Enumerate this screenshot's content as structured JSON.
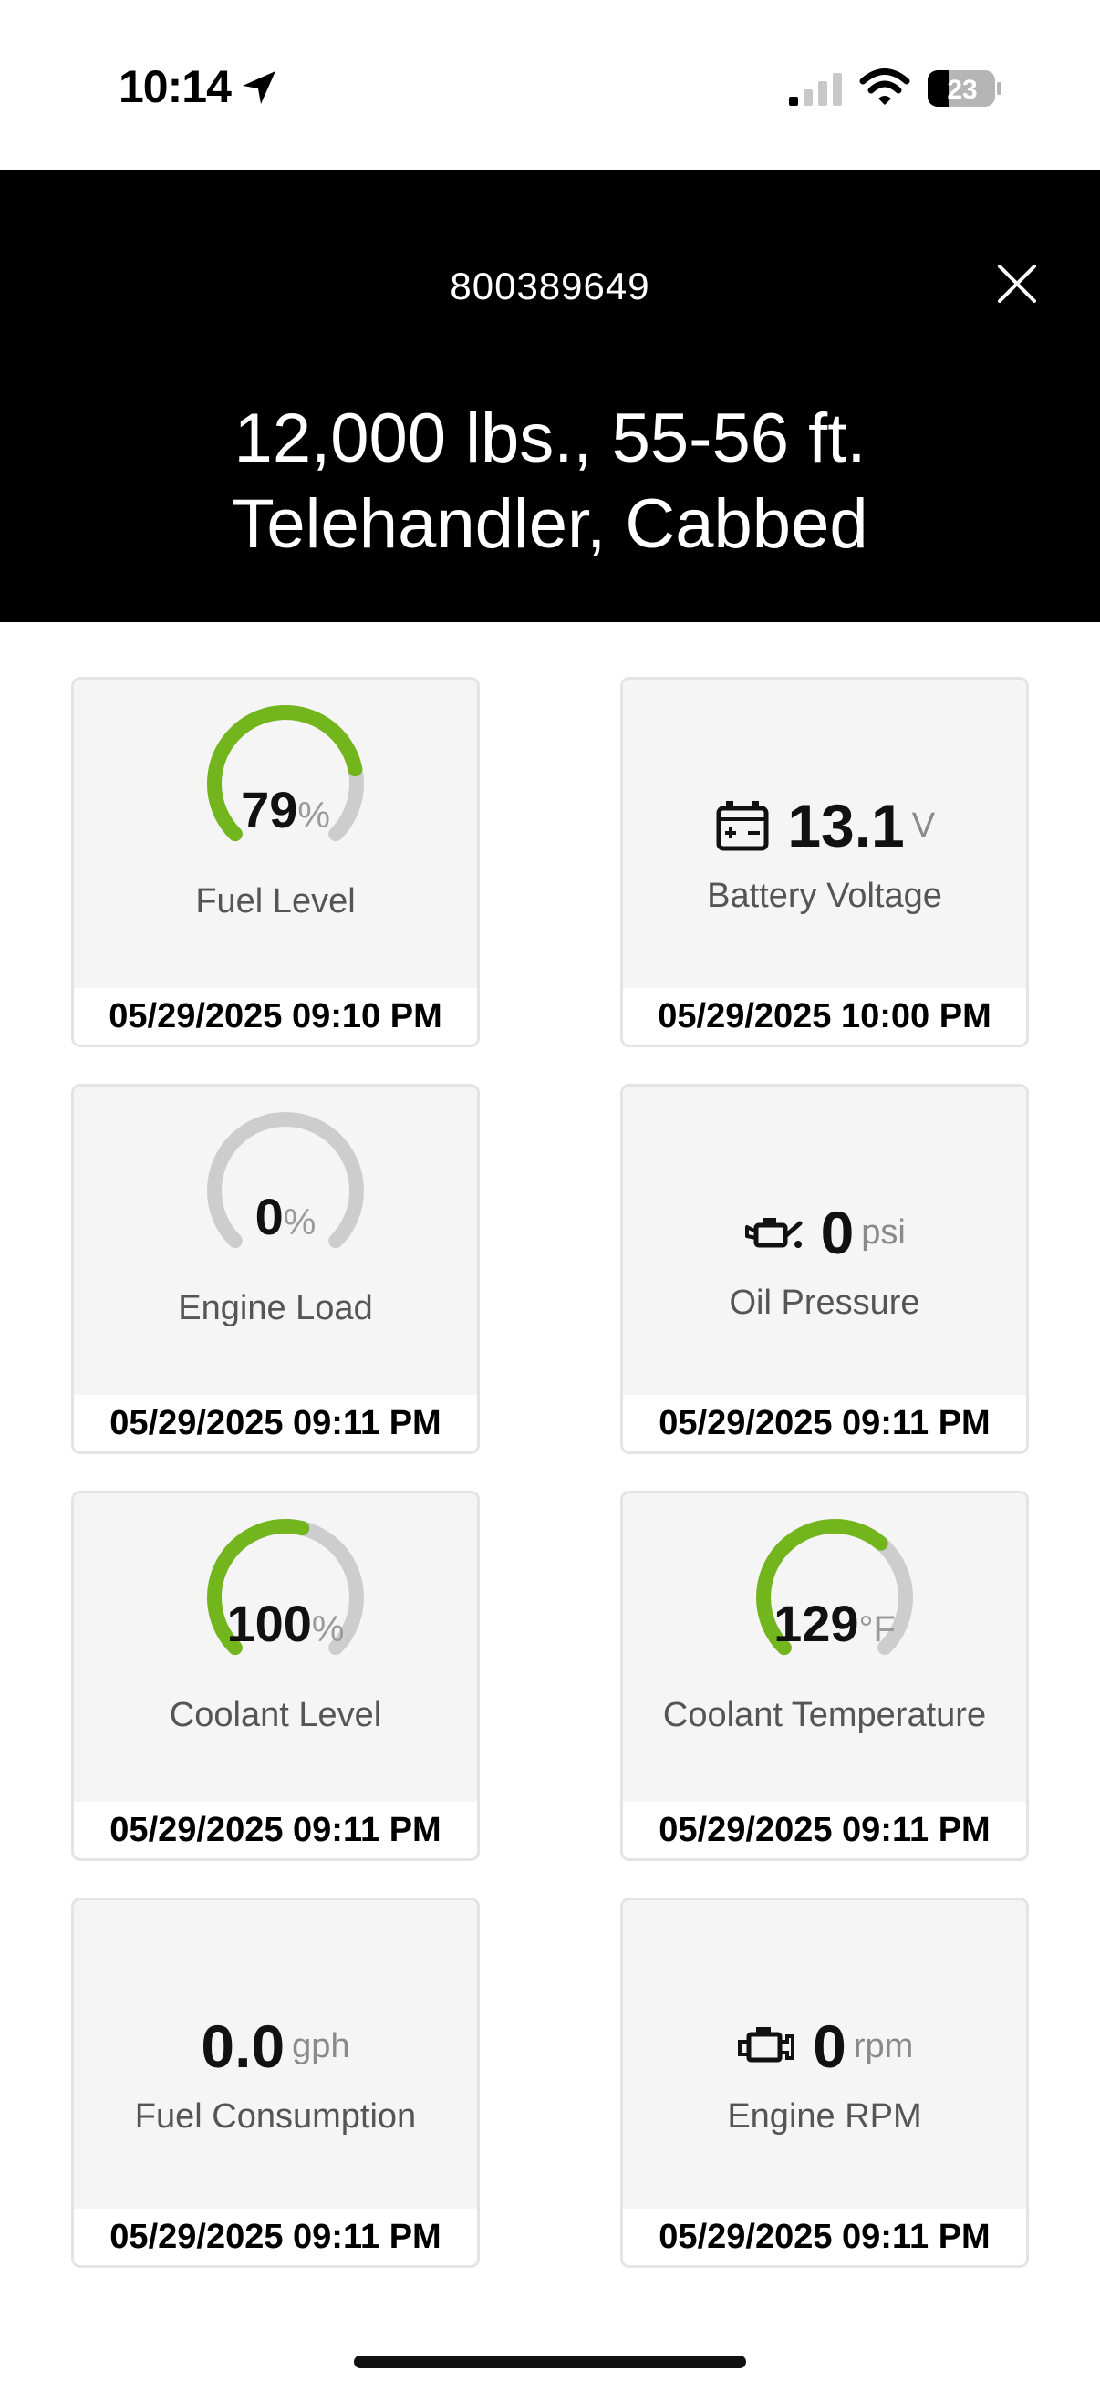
{
  "status_bar": {
    "time": "10:14",
    "battery": "23"
  },
  "header": {
    "asset_id": "800389649",
    "title_line1": "12,000 lbs., 55-56 ft.",
    "title_line2": "Telehandler, Cabbed"
  },
  "colors": {
    "gauge_fill": "#72b51d",
    "gauge_track": "#cdcdcd",
    "header_bg": "#000000"
  },
  "cards": [
    {
      "label": "Fuel Level",
      "value": "79",
      "unit": "%",
      "gauge_fraction": 0.79,
      "timestamp": "05/29/2025 09:10 PM",
      "type": "gauge"
    },
    {
      "label": "Battery Voltage",
      "value": "13.1",
      "unit": "V",
      "icon": "battery-icon",
      "timestamp": "05/29/2025 10:00 PM",
      "type": "icon"
    },
    {
      "label": "Engine Load",
      "value": "0",
      "unit": "%",
      "gauge_fraction": 0.0,
      "timestamp": "05/29/2025 09:11 PM",
      "type": "gauge"
    },
    {
      "label": "Oil Pressure",
      "value": "0",
      "unit": "psi",
      "icon": "oil-can-icon",
      "timestamp": "05/29/2025 09:11 PM",
      "type": "icon"
    },
    {
      "label": "Coolant Level",
      "value": "100",
      "unit": "%",
      "gauge_fraction": 0.55,
      "timestamp": "05/29/2025 09:11 PM",
      "type": "gauge"
    },
    {
      "label": "Coolant Temperature",
      "value": "129",
      "unit": "°F",
      "gauge_fraction": 0.65,
      "timestamp": "05/29/2025 09:11 PM",
      "type": "gauge"
    },
    {
      "label": "Fuel Consumption",
      "value": "0.0",
      "unit": "gph",
      "timestamp": "05/29/2025 09:11 PM",
      "type": "plain"
    },
    {
      "label": "Engine RPM",
      "value": "0",
      "unit": "rpm",
      "icon": "engine-icon",
      "timestamp": "05/29/2025 09:11 PM",
      "type": "icon"
    }
  ]
}
